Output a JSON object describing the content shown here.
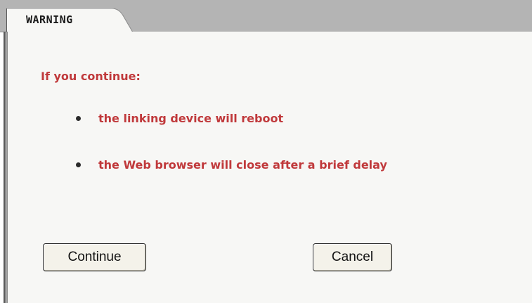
{
  "dialog": {
    "tab_title": "WARNING",
    "intro": "If you continue:",
    "bullets": [
      "the linking device will reboot",
      "the Web browser will close after a brief delay"
    ],
    "buttons": {
      "continue_label": "Continue",
      "cancel_label": "Cancel"
    }
  },
  "colors": {
    "warning_text": "#c0393b",
    "header_band": "#b4b4b4",
    "panel_bg": "#f7f7f5"
  }
}
